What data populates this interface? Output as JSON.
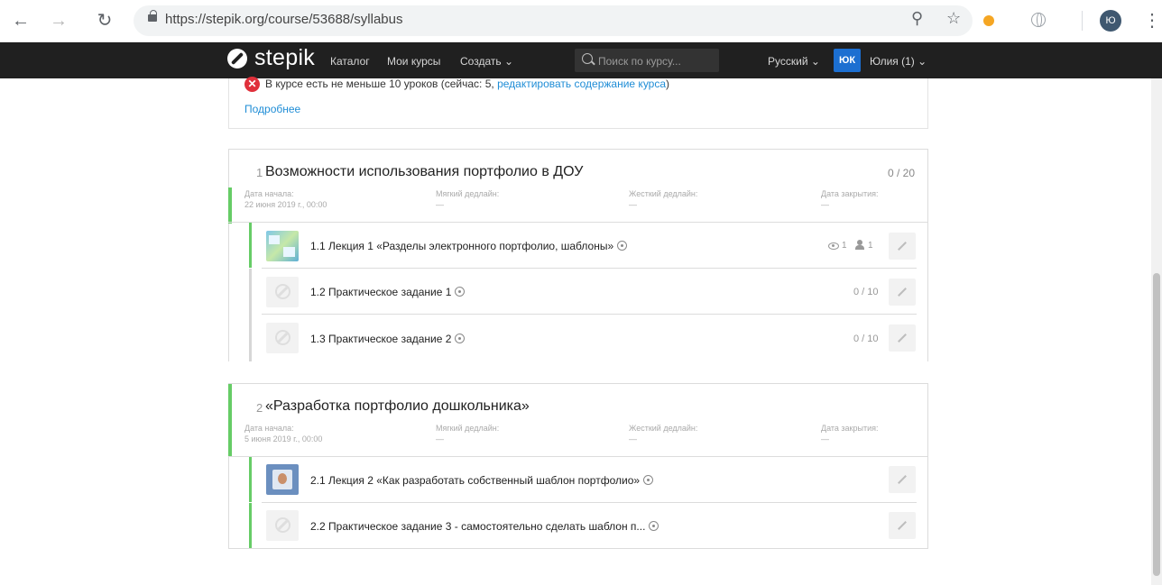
{
  "browser": {
    "url": "https://stepik.org/course/53688/syllabus",
    "profile_initial": "Ю"
  },
  "topbar": {
    "logo": "stepik",
    "catalog": "Каталог",
    "my_courses": "Мои курсы",
    "create": "Создать ⌄",
    "search_placeholder": "Поиск по курсу...",
    "language": "Русский ⌄",
    "avatar_initials": "ЮК",
    "user_name": "Юлия (1) ⌄"
  },
  "warning": {
    "text": "В курсе есть не меньше 10 уроков (сейчас: 5, ",
    "link": "редактировать содержание курса",
    "closing": ")",
    "more": "Подробнее"
  },
  "meta_labels": {
    "start": "Дата начала:",
    "soft": "Мягкий дедлайн:",
    "hard": "Жесткий дедлайн:",
    "close": "Дата закрытия:"
  },
  "sections": [
    {
      "number": "1",
      "title": "Возможности использования портфолио в ДОУ",
      "score": "0 / 20",
      "start_value": "22 июня 2019 г., 00:00",
      "soft_value": "—",
      "hard_value": "—",
      "close_value": "—",
      "lessons": [
        {
          "title": "1.1 Лекция 1 «Разделы электронного портфолио, шаблоны»",
          "views": "1",
          "learners": "1"
        },
        {
          "title": "1.2 Практическое задание 1",
          "score": "0 / 10"
        },
        {
          "title": "1.3 Практическое задание 2",
          "score": "0 / 10"
        }
      ]
    },
    {
      "number": "2",
      "title": "«Разработка портфолио дошкольника»",
      "start_value": "5 июня 2019 г., 00:00",
      "soft_value": "—",
      "hard_value": "—",
      "close_value": "—",
      "lessons": [
        {
          "title": "2.1 Лекция 2 «Как разработать собственный шаблон портфолио»"
        },
        {
          "title": "2.2 Практическое задание 3 - самостоятельно сделать шаблон п..."
        }
      ]
    }
  ],
  "colors": {
    "accent_green": "#66cc66",
    "link_blue": "#1f8dd6",
    "topbar_bg": "#202020",
    "avatar_blue": "#1c6fd1",
    "error_red": "#e0303b"
  }
}
